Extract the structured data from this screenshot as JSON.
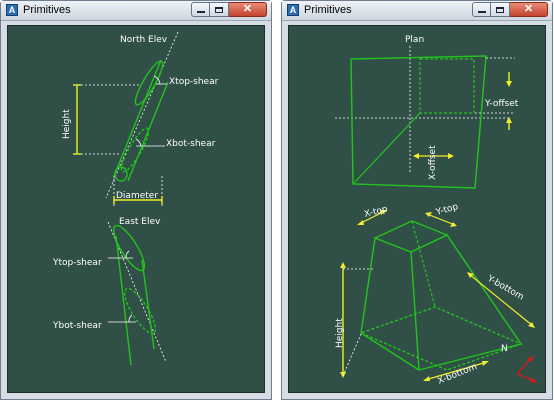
{
  "windows": [
    {
      "title": "Primitives",
      "labels": {
        "north_elev": "North Elev",
        "xtop_shear": "Xtop-shear",
        "height": "Height",
        "xbot_shear": "Xbot-shear",
        "diameter": "Diameter",
        "east_elev": "East Elev",
        "ytop_shear": "Ytop-shear",
        "ybot_shear": "Ybot-shear"
      }
    },
    {
      "title": "Primitives",
      "labels": {
        "plan": "Plan",
        "y_offset": "Y-offset",
        "x_offset": "X-offset",
        "x_top": "X-top",
        "y_top": "Y-top",
        "y_bottom": "Y-bottom",
        "height": "Height",
        "x_bottom": "X-bottom",
        "north": "N"
      }
    }
  ],
  "colors": {
    "canvas_background": "#304f47",
    "geometry": "#22c41c",
    "dimension": "#f0ee2a",
    "axis_x": "#d11a1a"
  },
  "icons": [
    "app-icon",
    "minimize-icon",
    "maximize-icon",
    "close-icon",
    "ucs-axis-icon"
  ]
}
